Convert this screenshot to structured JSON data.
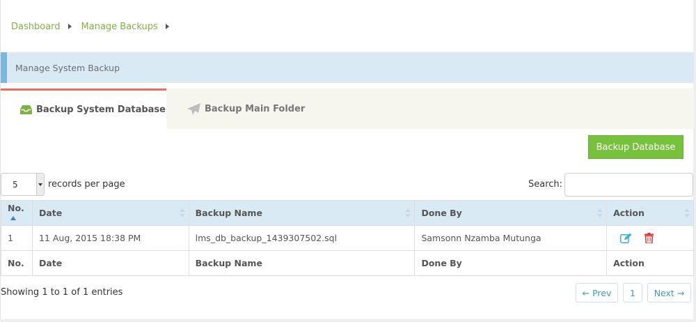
{
  "breadcrumb": {
    "items": [
      "Dashboard",
      "Manage Backups"
    ]
  },
  "panel": {
    "title": "Manage System Backup"
  },
  "tabs": [
    {
      "label": "Backup System Database",
      "icon": "inbox-icon",
      "active": true
    },
    {
      "label": "Backup Main Folder",
      "icon": "paper-plane-icon",
      "active": false
    }
  ],
  "actions": {
    "backup_label": "Backup Database"
  },
  "length": {
    "value": "5",
    "label": "records per page"
  },
  "search": {
    "label": "Search:",
    "value": "",
    "placeholder": ""
  },
  "table": {
    "columns": [
      "No.",
      "Date",
      "Backup Name",
      "Done By",
      "Action"
    ],
    "rows": [
      {
        "no": "1",
        "date": "11 Aug, 2015 18:38 PM",
        "name": "lms_db_backup_1439307502.sql",
        "done_by": "Samsonn Nzamba Mutunga"
      }
    ]
  },
  "footer": {
    "info": "Showing 1 to 1 of 1 entries"
  },
  "pagination": {
    "prev": "← Prev",
    "page": "1",
    "next": "Next →"
  },
  "colors": {
    "accent_green": "#77c23c",
    "tab_active_border": "#ee6e5e",
    "header_blue": "#daeaf5",
    "edit_icon": "#3ab0e2",
    "delete_icon": "#e03030"
  }
}
